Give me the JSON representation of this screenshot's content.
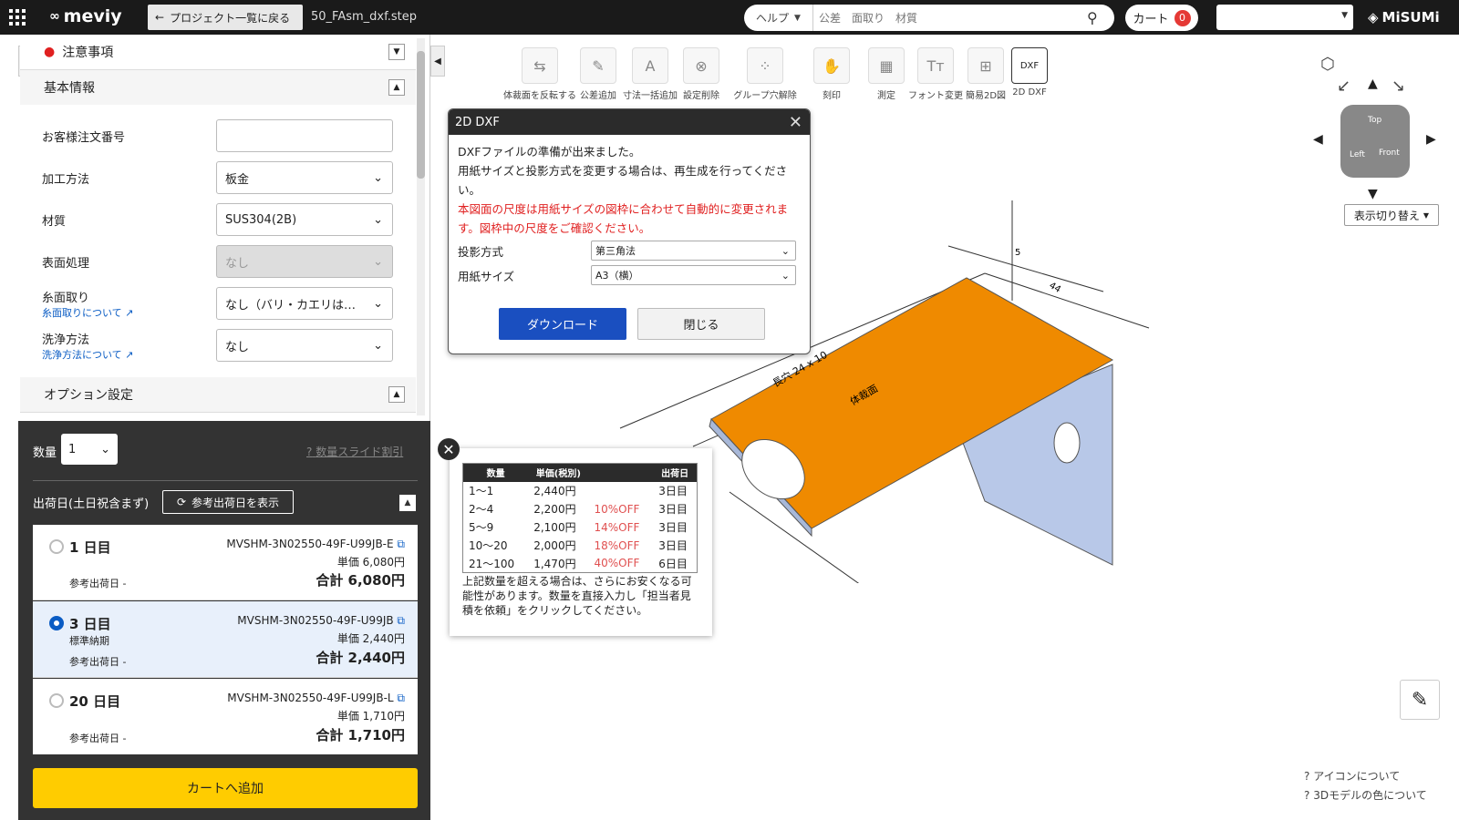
{
  "topbar": {
    "logo": "meviy",
    "back_label": "プロジェクト一覧に戻る",
    "filename": "50_FAsm_dxf.step",
    "help_label": "ヘルプ",
    "search_placeholder": "公差　面取り　材質",
    "cart_label": "カート",
    "cart_count": "0",
    "brand": "MiSUMi"
  },
  "left": {
    "notice": "注意事項",
    "basic": "基本情報",
    "fields": [
      {
        "label": "お客様注文番号",
        "value": ""
      },
      {
        "label": "加工方法",
        "value": "板金"
      },
      {
        "label": "材質",
        "value": "SUS304(2B)"
      },
      {
        "label": "表面処理",
        "value": "なし"
      },
      {
        "label": "糸面取り",
        "sub": "糸面取りについて",
        "value": "なし（バリ・カエリは…"
      },
      {
        "label": "洗浄方法",
        "sub": "洗浄方法について",
        "value": "なし"
      }
    ],
    "option_settings": "オプション設定"
  },
  "order": {
    "qty_label": "数量",
    "qty_value": "1",
    "slide_discount": "数量スライド割引",
    "ship_label": "出荷日(土日祝含まず)",
    "ref_btn": "参考出荷日を表示",
    "options": [
      {
        "days": "1 日目",
        "code": "MVSHM-3N02550-49F-U99JB-E",
        "unit": "単価 6,080円",
        "total": "合計 6,080円",
        "note": "",
        "ref": "参考出荷日 -"
      },
      {
        "days": "3 日目",
        "code": "MVSHM-3N02550-49F-U99JB",
        "unit": "単価 2,440円",
        "total": "合計 2,440円",
        "note": "標準納期",
        "ref": "参考出荷日 -"
      },
      {
        "days": "20 日目",
        "code": "MVSHM-3N02550-49F-U99JB-L",
        "unit": "単価 1,710円",
        "total": "合計 1,710円",
        "note": "",
        "ref": "参考出荷日 -"
      }
    ],
    "add_cart": "カートへ追加"
  },
  "toolbar": [
    "体裁面を反転する",
    "公差追加",
    "寸法一括追加",
    "設定削除",
    "グループ穴解除",
    "刻印",
    "測定",
    "フォント変更",
    "簡易2D図",
    "2D DXF"
  ],
  "viewcube": {
    "toggle": "表示切り替え",
    "top": "Top",
    "left": "Left",
    "front": "Front"
  },
  "dialog": {
    "title": "2D DXF",
    "line1": "DXFファイルの準備が出来ました。",
    "line2": "用紙サイズと投影方式を変更する場合は、再生成を行ってください。",
    "warn": "本図面の尺度は用紙サイズの図枠に合わせて自動的に変更されます。図枠中の尺度をご確認ください。",
    "proj_label": "投影方式",
    "proj_value": "第三角法",
    "paper_label": "用紙サイズ",
    "paper_value": "A3（横）",
    "download": "ダウンロード",
    "close": "閉じる"
  },
  "price": {
    "headers": [
      "数量",
      "単価(税別)",
      "",
      "出荷日"
    ],
    "rows": [
      [
        "1～1",
        "2,440円",
        "",
        "3日目"
      ],
      [
        "2～4",
        "2,200円",
        "10%OFF",
        "3日目"
      ],
      [
        "5～9",
        "2,100円",
        "14%OFF",
        "3日目"
      ],
      [
        "10～20",
        "2,000円",
        "18%OFF",
        "3日目"
      ],
      [
        "21～100",
        "1,470円",
        "40%OFF",
        "6日目"
      ]
    ],
    "note": "上記数量を超える場合は、さらにお安くなる可能性があります。数量を直接入力し「担当者見積を依頼」をクリックしてください。"
  },
  "model": {
    "label1": "長穴 24 x 10",
    "label2": "体裁面",
    "dim1": "44",
    "dim2": "5"
  },
  "footer": {
    "icons": "アイコンについて",
    "colors": "3Dモデルの色について"
  }
}
